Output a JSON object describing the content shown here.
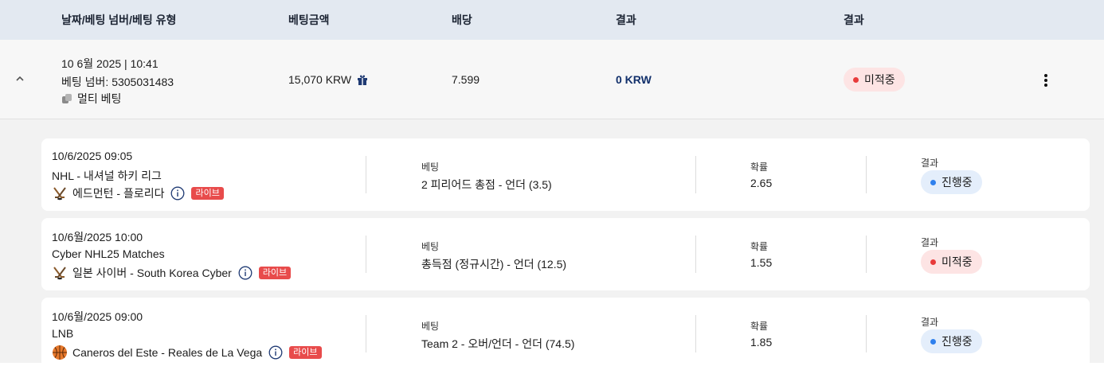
{
  "header": {
    "col_date": "날짜/베팅 넘버/베팅 유형",
    "col_amount": "베팅금액",
    "col_odds": "배당",
    "col_result": "결과",
    "col_status": "결과"
  },
  "summary": {
    "datetime": "10 6월 2025 | 10:41",
    "bet_number": "베팅 넘버: 5305031483",
    "bet_type": "멀티 베팅",
    "amount": "15,070 KRW",
    "odds": "7.599",
    "result": "0 KRW",
    "status": "미적중",
    "icons": [
      "chevron-up-icon",
      "multi-bet-icon",
      "gift-icon",
      "kebab-menu-icon"
    ]
  },
  "selections": [
    {
      "datetime": "10/6/2025 09:05",
      "league": "NHL - 내셔널 하키 리그",
      "match": "에드먼턴 - 플로리다",
      "sport_icon": "hockey-icon",
      "live": "라이브",
      "bet_label": "베팅",
      "bet": "2 피리어드 총점 - 언더 (3.5)",
      "odds_label": "확률",
      "odds": "2.65",
      "result_label": "결과",
      "status": "진행중",
      "status_color": "#2f80ed"
    },
    {
      "datetime": "10/6월/2025 10:00",
      "league": "Cyber NHL25 Matches",
      "match": "일본 사이버 - South Korea Cyber",
      "sport_icon": "hockey-icon",
      "live": "라이브",
      "bet_label": "베팅",
      "bet": "총득점 (정규시간) - 언더 (12.5)",
      "odds_label": "확률",
      "odds": "1.55",
      "result_label": "결과",
      "status": "미적중",
      "status_color": "#e83b3b"
    },
    {
      "datetime": "10/6월/2025 09:00",
      "league": "LNB",
      "match": "Caneros del Este - Reales de La Vega",
      "sport_icon": "basketball-icon",
      "live": "라이브",
      "bet_label": "베팅",
      "bet": "Team 2 - 오버/언더 - 언더 (74.5)",
      "odds_label": "확률",
      "odds": "1.85",
      "result_label": "결과",
      "status": "진행중",
      "status_color": "#2f80ed"
    }
  ]
}
